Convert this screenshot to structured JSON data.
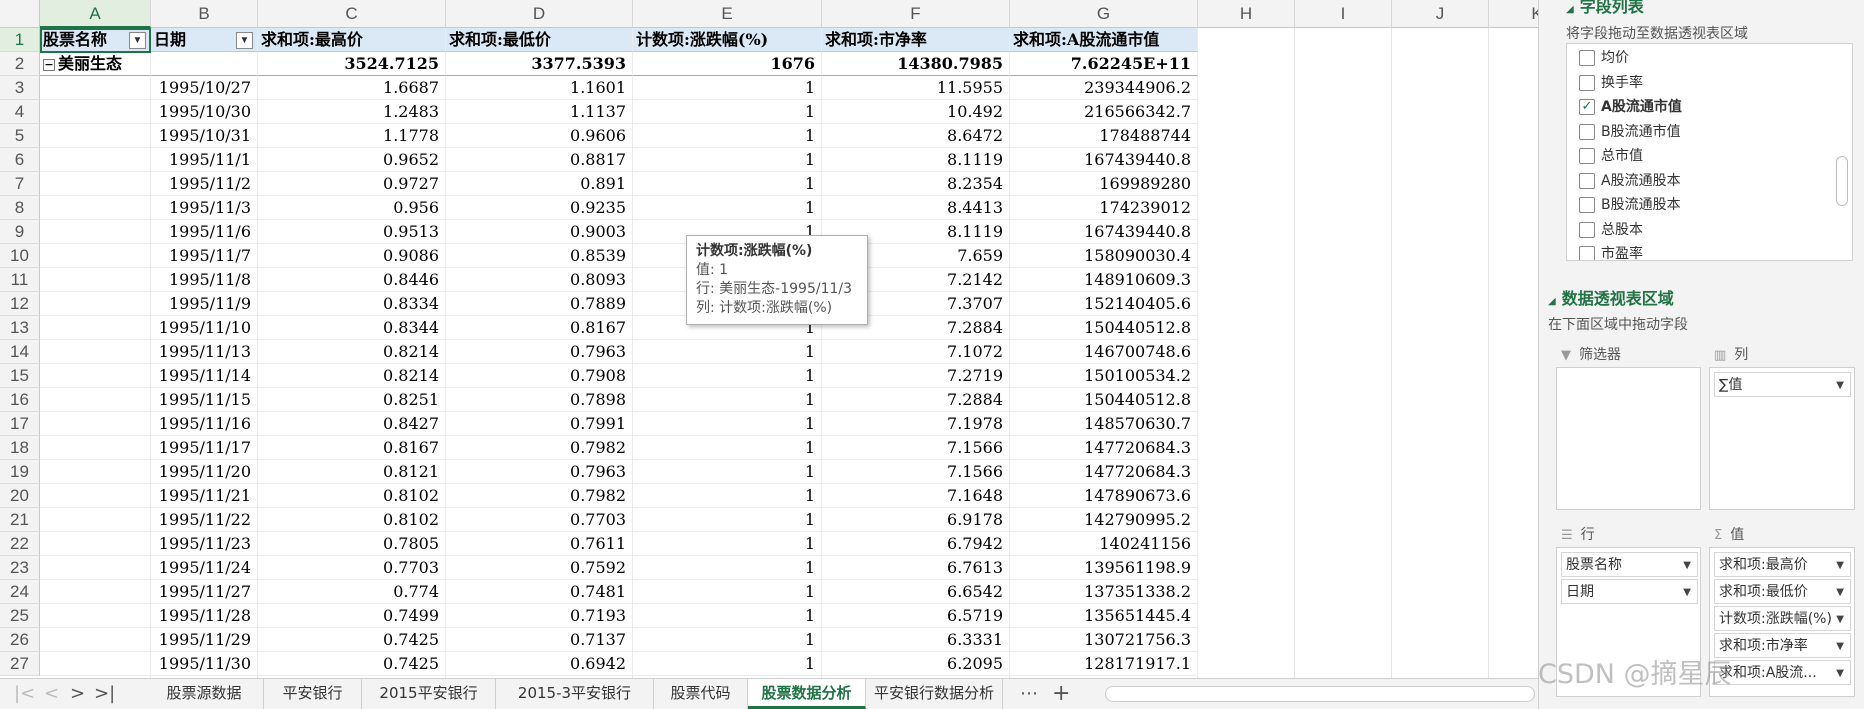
{
  "columns": [
    "A",
    "B",
    "C",
    "D",
    "E",
    "F",
    "G",
    "H",
    "I",
    "J",
    "K"
  ],
  "rows": [
    "1",
    "2",
    "3",
    "4",
    "5",
    "6",
    "7",
    "8",
    "9",
    "10",
    "11",
    "12",
    "13",
    "14",
    "15",
    "16",
    "17",
    "18",
    "19",
    "20",
    "21",
    "22",
    "23",
    "24",
    "25",
    "26",
    "27"
  ],
  "pivot": {
    "headers": [
      "股票名称",
      "日期",
      "求和项:最高价",
      "求和项:最低价",
      "计数项:涨跌幅(%)",
      "求和项:市净率",
      "求和项:A股流通市值"
    ],
    "total_row": {
      "name": "美丽生态",
      "collapse_symbol": "−",
      "values": [
        "3524.7125",
        "3377.5393",
        "1676",
        "14380.7985",
        "7.62245E+11"
      ]
    },
    "data_rows": [
      [
        "1995/10/27",
        "1.6687",
        "1.1601",
        "1",
        "11.5955",
        "239344906.2"
      ],
      [
        "1995/10/30",
        "1.2483",
        "1.1137",
        "1",
        "10.492",
        "216566342.7"
      ],
      [
        "1995/10/31",
        "1.1778",
        "0.9606",
        "1",
        "8.6472",
        "178488744"
      ],
      [
        "1995/11/1",
        "0.9652",
        "0.8817",
        "1",
        "8.1119",
        "167439440.8"
      ],
      [
        "1995/11/2",
        "0.9727",
        "0.891",
        "1",
        "8.2354",
        "169989280"
      ],
      [
        "1995/11/3",
        "0.956",
        "0.9235",
        "1",
        "8.4413",
        "174239012"
      ],
      [
        "1995/11/6",
        "0.9513",
        "0.9003",
        "1",
        "8.1119",
        "167439440.8"
      ],
      [
        "1995/11/7",
        "0.9086",
        "0.8539",
        "1",
        "7.659",
        "158090030.4"
      ],
      [
        "1995/11/8",
        "0.8446",
        "0.8093",
        "1",
        "7.2142",
        "148910609.3"
      ],
      [
        "1995/11/9",
        "0.8334",
        "0.7889",
        "1",
        "7.3707",
        "152140405.6"
      ],
      [
        "1995/11/10",
        "0.8344",
        "0.8167",
        "1",
        "7.2884",
        "150440512.8"
      ],
      [
        "1995/11/13",
        "0.8214",
        "0.7963",
        "1",
        "7.1072",
        "146700748.6"
      ],
      [
        "1995/11/14",
        "0.8214",
        "0.7908",
        "1",
        "7.2719",
        "150100534.2"
      ],
      [
        "1995/11/15",
        "0.8251",
        "0.7898",
        "1",
        "7.2884",
        "150440512.8"
      ],
      [
        "1995/11/16",
        "0.8427",
        "0.7991",
        "1",
        "7.1978",
        "148570630.7"
      ],
      [
        "1995/11/17",
        "0.8167",
        "0.7982",
        "1",
        "7.1566",
        "147720684.3"
      ],
      [
        "1995/11/20",
        "0.8121",
        "0.7963",
        "1",
        "7.1566",
        "147720684.3"
      ],
      [
        "1995/11/21",
        "0.8102",
        "0.7982",
        "1",
        "7.1648",
        "147890673.6"
      ],
      [
        "1995/11/22",
        "0.8102",
        "0.7703",
        "1",
        "6.9178",
        "142790995.2"
      ],
      [
        "1995/11/23",
        "0.7805",
        "0.7611",
        "1",
        "6.7942",
        "140241156"
      ],
      [
        "1995/11/24",
        "0.7703",
        "0.7592",
        "1",
        "6.7613",
        "139561198.9"
      ],
      [
        "1995/11/27",
        "0.774",
        "0.7481",
        "1",
        "6.6542",
        "137351338.2"
      ],
      [
        "1995/11/28",
        "0.7499",
        "0.7193",
        "1",
        "6.5719",
        "135651445.4"
      ],
      [
        "1995/11/29",
        "0.7425",
        "0.7137",
        "1",
        "6.3331",
        "130721756.3"
      ],
      [
        "1995/11/30",
        "0.7425",
        "0.6942",
        "1",
        "6.2095",
        "128171917.1"
      ]
    ]
  },
  "tooltip": {
    "title": "计数项:涨跌幅(%)",
    "value": "值: 1",
    "row": "行: 美丽生态-1995/11/3",
    "col": "列: 计数项:涨跌幅(%)"
  },
  "tabs": {
    "nav": [
      "|<",
      "<",
      ">",
      ">|"
    ],
    "sheets": [
      "股票源数据",
      "平安银行",
      "2015平安银行",
      "2015-3平安银行",
      "股票代码",
      "股票数据分析",
      "平安银行数据分析"
    ],
    "active_index": 5,
    "more": "⋯",
    "add": "+"
  },
  "pane": {
    "fields_title": "字段列表",
    "fields_hint": "将字段拖动至数据透视表区域",
    "fields": [
      {
        "label": "均价",
        "checked": false
      },
      {
        "label": "换手率",
        "checked": false
      },
      {
        "label": "A股流通市值",
        "checked": true
      },
      {
        "label": "B股流通市值",
        "checked": false
      },
      {
        "label": "总市值",
        "checked": false
      },
      {
        "label": "A股流通股本",
        "checked": false
      },
      {
        "label": "B股流通股本",
        "checked": false
      },
      {
        "label": "总股本",
        "checked": false
      },
      {
        "label": "市盈率",
        "checked": false
      }
    ],
    "areas_title": "数据透视表区域",
    "areas_hint": "在下面区域中拖动字段",
    "filter_label": "筛选器",
    "columns_label": "列",
    "rows_label": "行",
    "values_label": "值",
    "columns_items": [
      "∑值"
    ],
    "rows_items": [
      "股票名称",
      "日期"
    ],
    "values_items": [
      "求和项:最高价",
      "求和项:最低价",
      "计数项:涨跌幅(%)",
      "求和项:市净率",
      "求和项:A股流..."
    ]
  },
  "watermark": "CSDN @摘星辰",
  "colors": {
    "accent": "#217346",
    "header_fill": "#dbe8f5"
  }
}
